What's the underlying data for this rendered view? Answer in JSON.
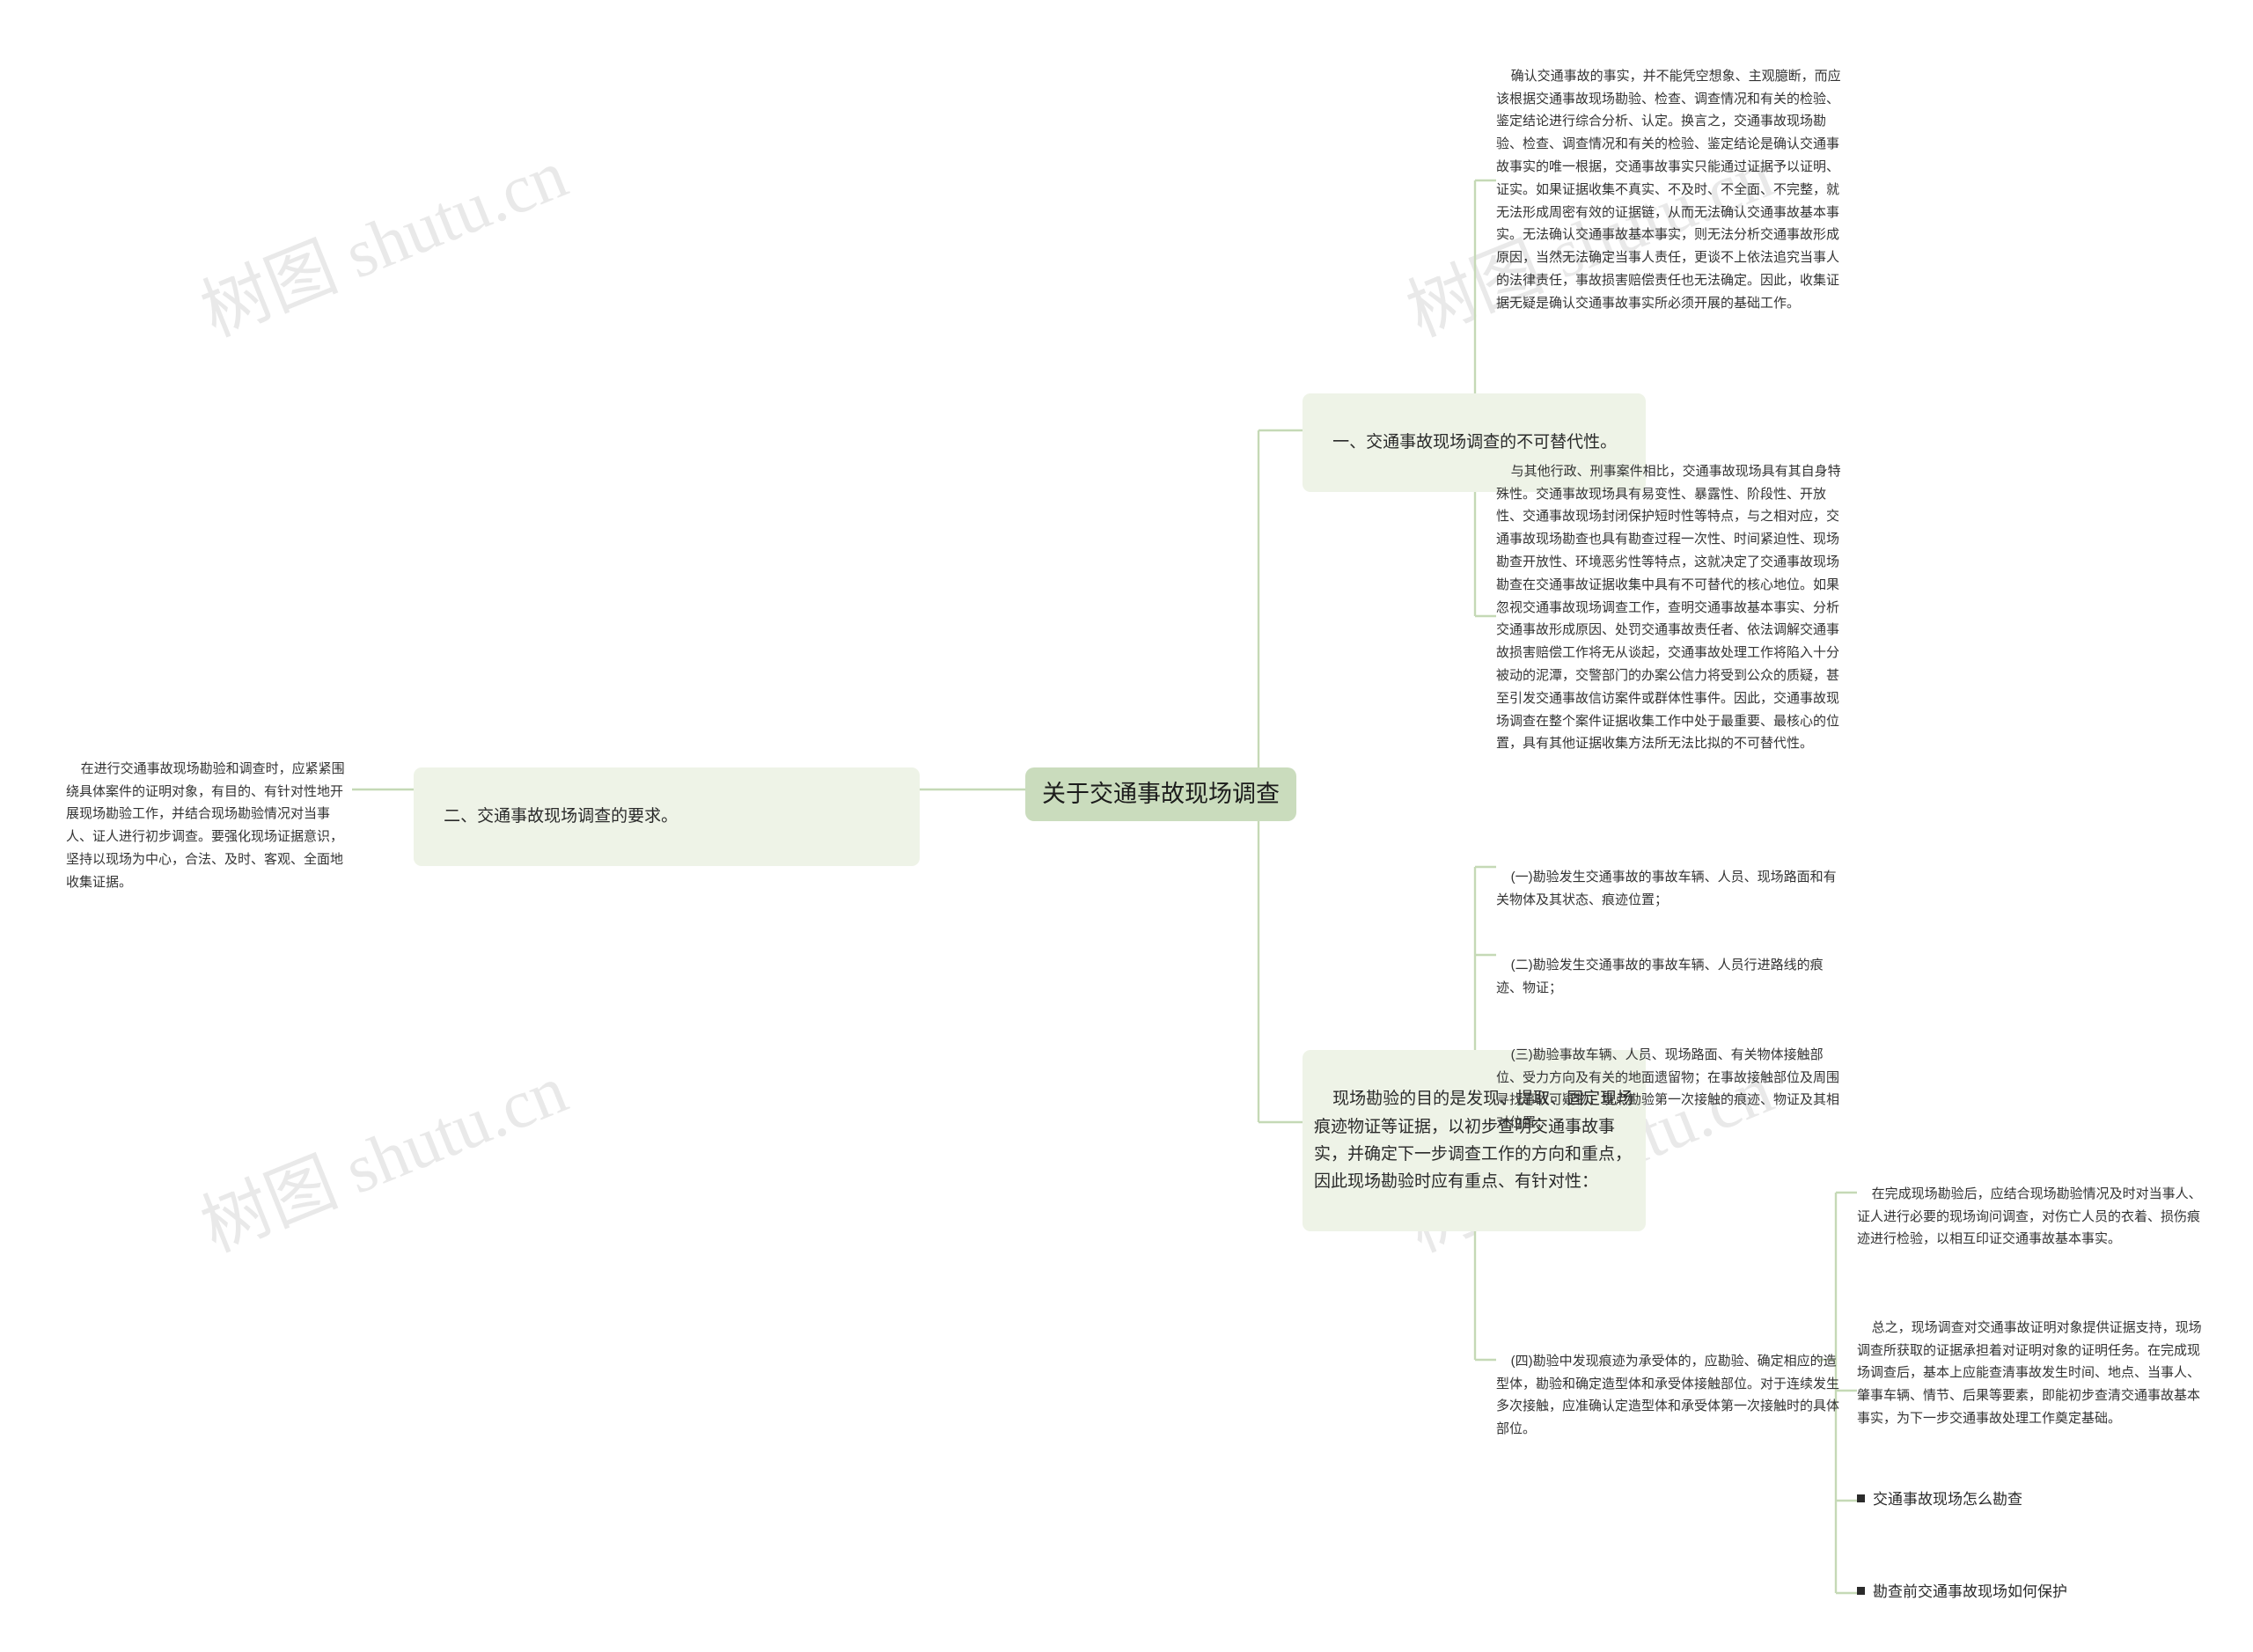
{
  "meta": {
    "title": "关于交通事故现场调查",
    "accent": "#cadcbd",
    "node_bg": "#eef3e7",
    "line_color": "#c5d9b6",
    "text_color": "#222222",
    "watermark_text": "树图 shutu.cn"
  },
  "root": {
    "label": "关于交通事故现场调查"
  },
  "branches": {
    "left": [
      {
        "label": "二、交通事故现场调查的要求。",
        "children": [
          {
            "label": "在进行交通事故现场勘验和调查时，应紧紧围绕具体案件的证明对象，有目的、有针对性地开展现场勘验工作，并结合现场勘验情况对当事人、证人进行初步调查。要强化现场证据意识，坚持以现场为中心，合法、及时、客观、全面地收集证据。"
          }
        ]
      }
    ],
    "right": [
      {
        "label": "一、交通事故现场调查的不可替代性。",
        "children": [
          {
            "label": "确认交通事故的事实，并不能凭空想象、主观臆断，而应该根据交通事故现场勘验、检查、调查情况和有关的检验、鉴定结论进行综合分析、认定。换言之，交通事故现场勘验、检查、调查情况和有关的检验、鉴定结论是确认交通事故事实的唯一根据，交通事故事实只能通过证据予以证明、证实。如果证据收集不真实、不及时、不全面、不完整，就无法形成周密有效的证据链，从而无法确认交通事故基本事实。无法确认交通事故基本事实，则无法分析交通事故形成原因，当然无法确定当事人责任，更谈不上依法追究当事人的法律责任，事故损害赔偿责任也无法确定。因此，收集证据无疑是确认交通事故事实所必须开展的基础工作。"
          },
          {
            "label": "与其他行政、刑事案件相比，交通事故现场具有其自身特殊性。交通事故现场具有易变性、暴露性、阶段性、开放性、交通事故现场封闭保护短时性等特点，与之相对应，交通事故现场勘查也具有勘查过程一次性、时间紧迫性、现场勘查开放性、环境恶劣性等特点，这就决定了交通事故现场勘查在交通事故证据收集中具有不可替代的核心地位。如果忽视交通事故现场调查工作，查明交通事故基本事实、分析交通事故形成原因、处罚交通事故责任者、依法调解交通事故损害赔偿工作将无从谈起，交通事故处理工作将陷入十分被动的泥潭，交警部门的办案公信力将受到公众的质疑，甚至引发交通事故信访案件或群体性事件。因此，交通事故现场调查在整个案件证据收集工作中处于最重要、最核心的位置，具有其他证据收集方法所无法比拟的不可替代性。"
          }
        ]
      },
      {
        "label": "现场勘验的目的是发现、提取、固定现场痕迹物证等证据，以初步查明交通事故事实，并确定下一步调查工作的方向和重点，因此现场勘验时应有重点、有针对性：",
        "children": [
          {
            "label": "(一)勘验发生交通事故的事故车辆、人员、现场路面和有关物体及其状态、痕迹位置；"
          },
          {
            "label": "(二)勘验发生交通事故的事故车辆、人员行进路线的痕迹、物证；"
          },
          {
            "label": "(三)勘验事故车辆、人员、现场路面、有关物体接触部位、受力方向及有关的地面遗留物；在事故接触部位及周围寻找事故可疑物，重点勘验第一次接触的痕迹、物证及其相对位置；"
          },
          {
            "label": "(四)勘验中发现痕迹为承受体的，应勘验、确定相应的造型体，勘验和确定造型体和承受体接触部位。对于连续发生多次接触，应准确认定造型体和承受体第一次接触时的具体部位。",
            "children": [
              {
                "label": "在完成现场勘验后，应结合现场勘验情况及时对当事人、证人进行必要的现场询问调查，对伤亡人员的衣着、损伤痕迹进行检验，以相互印证交通事故基本事实。"
              },
              {
                "label": "总之，现场调查对交通事故证明对象提供证据支持，现场调查所获取的证据承担着对证明对象的证明任务。在完成现场调查后，基本上应能查清事故发生时间、地点、当事人、肇事车辆、情节、后果等要素，即能初步查清交通事故基本事实，为下一步交通事故处理工作奠定基础。"
              }
            ]
          }
        ]
      }
    ]
  },
  "related_links": [
    {
      "label": "交通事故现场怎么勘查"
    },
    {
      "label": "勘查前交通事故现场如何保护"
    }
  ]
}
